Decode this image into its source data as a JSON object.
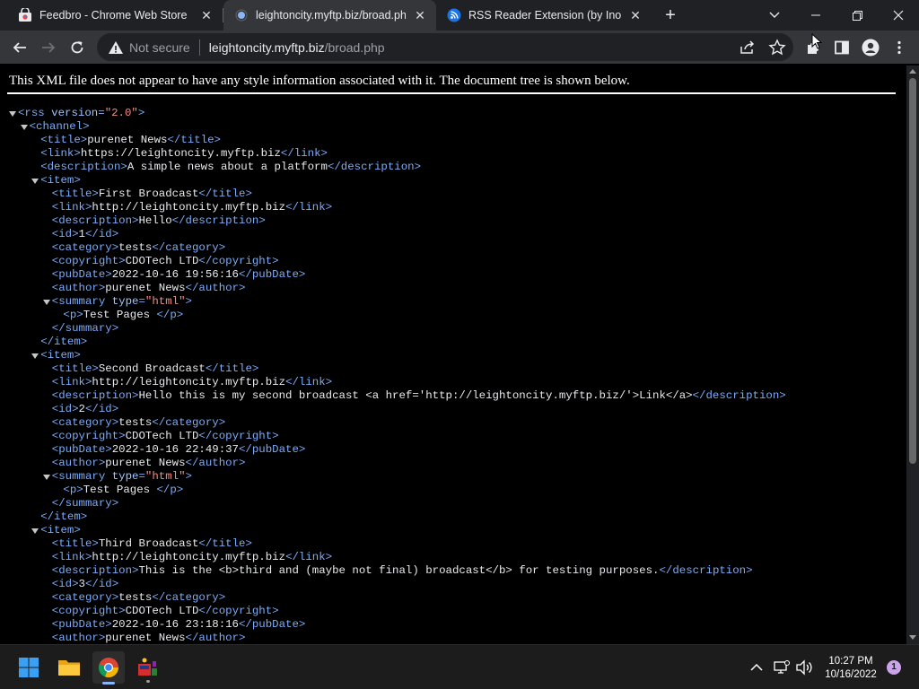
{
  "tabs": [
    {
      "title": "Feedbro - Chrome Web Store",
      "active": false
    },
    {
      "title": "leightoncity.myftp.biz/broad.php",
      "active": true
    },
    {
      "title": "RSS Reader Extension (by Inoreader)",
      "active": false
    }
  ],
  "omnibox": {
    "security_label": "Not secure",
    "host": "leightoncity.myftp.biz",
    "path": "/broad.php"
  },
  "content": {
    "notice": "This XML file does not appear to have any style information associated with it. The document tree is shown below.",
    "xml_lines": [
      {
        "indent": 0,
        "toggle": true,
        "parts": [
          [
            "tg",
            "<rss"
          ],
          [
            "an",
            " version"
          ],
          [
            "tg",
            "="
          ],
          [
            "av",
            "\"2.0\""
          ],
          [
            "tg",
            ">"
          ]
        ]
      },
      {
        "indent": 1,
        "toggle": true,
        "parts": [
          [
            "tg",
            "<channel>"
          ]
        ]
      },
      {
        "indent": 2,
        "parts": [
          [
            "tg",
            "<title>"
          ],
          [
            "tx",
            "purenet News"
          ],
          [
            "tg",
            "</title>"
          ]
        ]
      },
      {
        "indent": 2,
        "parts": [
          [
            "tg",
            "<link>"
          ],
          [
            "tx",
            "https://leightoncity.myftp.biz"
          ],
          [
            "tg",
            "</link>"
          ]
        ]
      },
      {
        "indent": 2,
        "parts": [
          [
            "tg",
            "<description>"
          ],
          [
            "tx",
            "A simple news about a platform"
          ],
          [
            "tg",
            "</description>"
          ]
        ]
      },
      {
        "indent": 2,
        "toggle": true,
        "parts": [
          [
            "tg",
            "<item>"
          ]
        ]
      },
      {
        "indent": 3,
        "parts": [
          [
            "tg",
            "<title>"
          ],
          [
            "tx",
            "First Broadcast"
          ],
          [
            "tg",
            "</title>"
          ]
        ]
      },
      {
        "indent": 3,
        "parts": [
          [
            "tg",
            "<link>"
          ],
          [
            "tx",
            "http://leightoncity.myftp.biz"
          ],
          [
            "tg",
            "</link>"
          ]
        ]
      },
      {
        "indent": 3,
        "parts": [
          [
            "tg",
            "<description>"
          ],
          [
            "tx",
            "Hello"
          ],
          [
            "tg",
            "</description>"
          ]
        ]
      },
      {
        "indent": 3,
        "parts": [
          [
            "tg",
            "<id>"
          ],
          [
            "tx",
            "1"
          ],
          [
            "tg",
            "</id>"
          ]
        ]
      },
      {
        "indent": 3,
        "parts": [
          [
            "tg",
            "<category>"
          ],
          [
            "tx",
            "tests"
          ],
          [
            "tg",
            "</category>"
          ]
        ]
      },
      {
        "indent": 3,
        "parts": [
          [
            "tg",
            "<copyright>"
          ],
          [
            "tx",
            "CDOTech LTD"
          ],
          [
            "tg",
            "</copyright>"
          ]
        ]
      },
      {
        "indent": 3,
        "parts": [
          [
            "tg",
            "<pubDate>"
          ],
          [
            "tx",
            "2022-10-16 19:56:16"
          ],
          [
            "tg",
            "</pubDate>"
          ]
        ]
      },
      {
        "indent": 3,
        "parts": [
          [
            "tg",
            "<author>"
          ],
          [
            "tx",
            "purenet News"
          ],
          [
            "tg",
            "</author>"
          ]
        ]
      },
      {
        "indent": 3,
        "toggle": true,
        "parts": [
          [
            "tg",
            "<summary"
          ],
          [
            "an",
            " type"
          ],
          [
            "tg",
            "="
          ],
          [
            "av",
            "\"html\""
          ],
          [
            "tg",
            ">"
          ]
        ]
      },
      {
        "indent": 4,
        "parts": [
          [
            "tg",
            "<p>"
          ],
          [
            "tx",
            "Test Pages "
          ],
          [
            "tg",
            "</p>"
          ]
        ]
      },
      {
        "indent": 3,
        "parts": [
          [
            "tg",
            "</summary>"
          ]
        ]
      },
      {
        "indent": 2,
        "parts": [
          [
            "tg",
            "</item>"
          ]
        ]
      },
      {
        "indent": 2,
        "toggle": true,
        "parts": [
          [
            "tg",
            "<item>"
          ]
        ]
      },
      {
        "indent": 3,
        "parts": [
          [
            "tg",
            "<title>"
          ],
          [
            "tx",
            "Second Broadcast"
          ],
          [
            "tg",
            "</title>"
          ]
        ]
      },
      {
        "indent": 3,
        "parts": [
          [
            "tg",
            "<link>"
          ],
          [
            "tx",
            "http://leightoncity.myftp.biz"
          ],
          [
            "tg",
            "</link>"
          ]
        ]
      },
      {
        "indent": 3,
        "parts": [
          [
            "tg",
            "<description>"
          ],
          [
            "tx",
            "Hello this is my second broadcast <a href='http://leightoncity.myftp.biz/'>Link</a>"
          ],
          [
            "tg",
            "</description>"
          ]
        ]
      },
      {
        "indent": 3,
        "parts": [
          [
            "tg",
            "<id>"
          ],
          [
            "tx",
            "2"
          ],
          [
            "tg",
            "</id>"
          ]
        ]
      },
      {
        "indent": 3,
        "parts": [
          [
            "tg",
            "<category>"
          ],
          [
            "tx",
            "tests"
          ],
          [
            "tg",
            "</category>"
          ]
        ]
      },
      {
        "indent": 3,
        "parts": [
          [
            "tg",
            "<copyright>"
          ],
          [
            "tx",
            "CDOTech LTD"
          ],
          [
            "tg",
            "</copyright>"
          ]
        ]
      },
      {
        "indent": 3,
        "parts": [
          [
            "tg",
            "<pubDate>"
          ],
          [
            "tx",
            "2022-10-16 22:49:37"
          ],
          [
            "tg",
            "</pubDate>"
          ]
        ]
      },
      {
        "indent": 3,
        "parts": [
          [
            "tg",
            "<author>"
          ],
          [
            "tx",
            "purenet News"
          ],
          [
            "tg",
            "</author>"
          ]
        ]
      },
      {
        "indent": 3,
        "toggle": true,
        "parts": [
          [
            "tg",
            "<summary"
          ],
          [
            "an",
            " type"
          ],
          [
            "tg",
            "="
          ],
          [
            "av",
            "\"html\""
          ],
          [
            "tg",
            ">"
          ]
        ]
      },
      {
        "indent": 4,
        "parts": [
          [
            "tg",
            "<p>"
          ],
          [
            "tx",
            "Test Pages "
          ],
          [
            "tg",
            "</p>"
          ]
        ]
      },
      {
        "indent": 3,
        "parts": [
          [
            "tg",
            "</summary>"
          ]
        ]
      },
      {
        "indent": 2,
        "parts": [
          [
            "tg",
            "</item>"
          ]
        ]
      },
      {
        "indent": 2,
        "toggle": true,
        "parts": [
          [
            "tg",
            "<item>"
          ]
        ]
      },
      {
        "indent": 3,
        "parts": [
          [
            "tg",
            "<title>"
          ],
          [
            "tx",
            "Third Broadcast"
          ],
          [
            "tg",
            "</title>"
          ]
        ]
      },
      {
        "indent": 3,
        "parts": [
          [
            "tg",
            "<link>"
          ],
          [
            "tx",
            "http://leightoncity.myftp.biz"
          ],
          [
            "tg",
            "</link>"
          ]
        ]
      },
      {
        "indent": 3,
        "parts": [
          [
            "tg",
            "<description>"
          ],
          [
            "tx",
            "This is the <b>third and (maybe not final) broadcast</b> for testing purposes."
          ],
          [
            "tg",
            "</description>"
          ]
        ]
      },
      {
        "indent": 3,
        "parts": [
          [
            "tg",
            "<id>"
          ],
          [
            "tx",
            "3"
          ],
          [
            "tg",
            "</id>"
          ]
        ]
      },
      {
        "indent": 3,
        "parts": [
          [
            "tg",
            "<category>"
          ],
          [
            "tx",
            "tests"
          ],
          [
            "tg",
            "</category>"
          ]
        ]
      },
      {
        "indent": 3,
        "parts": [
          [
            "tg",
            "<copyright>"
          ],
          [
            "tx",
            "CDOTech LTD"
          ],
          [
            "tg",
            "</copyright>"
          ]
        ]
      },
      {
        "indent": 3,
        "parts": [
          [
            "tg",
            "<pubDate>"
          ],
          [
            "tx",
            "2022-10-16 23:18:16"
          ],
          [
            "tg",
            "</pubDate>"
          ]
        ]
      },
      {
        "indent": 3,
        "parts": [
          [
            "tg",
            "<author>"
          ],
          [
            "tx",
            "purenet News"
          ],
          [
            "tg",
            "</author>"
          ]
        ]
      }
    ]
  },
  "taskbar": {
    "apps": [
      "start-button",
      "file-explorer",
      "chrome",
      "app-tool"
    ],
    "time": "10:27 PM",
    "date": "10/16/2022",
    "notification_count": "1"
  },
  "colors": {
    "tab_strip": "#202124",
    "toolbar": "#35363a",
    "xml_tag": "#7cacf8",
    "xml_attr_value": "#f28b82",
    "taskbar": "#1c1c1c"
  }
}
